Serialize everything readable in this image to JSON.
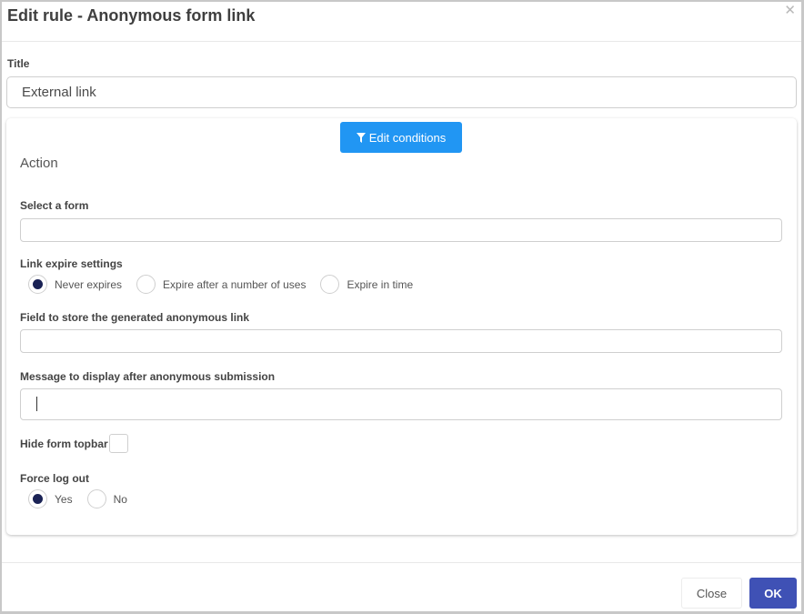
{
  "dialog": {
    "title": "Edit rule - Anonymous form link",
    "close_icon": "close-icon"
  },
  "title_field": {
    "label": "Title",
    "value": "External link"
  },
  "conditions": {
    "button_label": "Edit conditions",
    "icon": "filter-icon"
  },
  "action": {
    "heading": "Action",
    "select_form": {
      "label": "Select a form",
      "value": ""
    },
    "link_expire": {
      "label": "Link expire settings",
      "options": [
        {
          "label": "Never expires",
          "selected": true
        },
        {
          "label": "Expire after a number of uses",
          "selected": false
        },
        {
          "label": "Expire in time",
          "selected": false
        }
      ]
    },
    "store_field": {
      "label": "Field to store the generated anonymous link",
      "value": ""
    },
    "message": {
      "label": "Message to display after anonymous submission",
      "value": ""
    },
    "hide_topbar": {
      "label": "Hide form topbar",
      "checked": false
    },
    "force_logout": {
      "label": "Force log out",
      "options": [
        {
          "label": "Yes",
          "selected": true
        },
        {
          "label": "No",
          "selected": false
        }
      ]
    }
  },
  "footer": {
    "close_label": "Close",
    "ok_label": "OK"
  },
  "colors": {
    "primary_button": "#2196f3",
    "ok_button": "#3f51b5",
    "radio_selected": "#1a2255"
  }
}
